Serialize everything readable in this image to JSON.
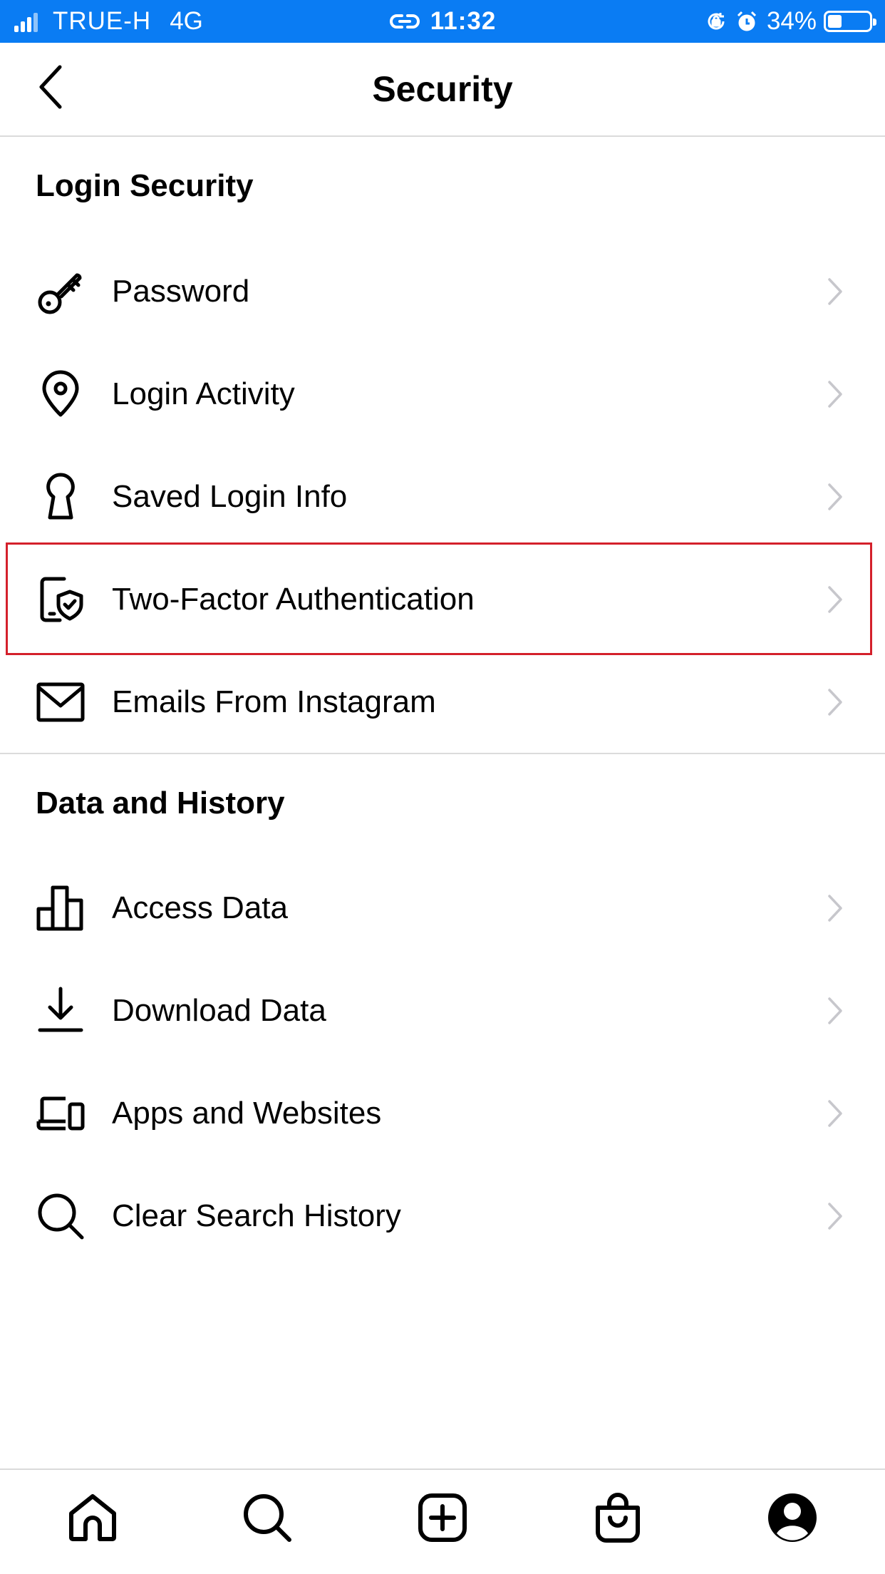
{
  "status_bar": {
    "carrier": "TRUE-H",
    "network": "4G",
    "time": "11:32",
    "battery_percent": "34%",
    "battery_level": 0.34
  },
  "header": {
    "title": "Security"
  },
  "sections": {
    "login_security": {
      "title": "Login Security",
      "items": [
        {
          "label": "Password",
          "icon": "key-icon"
        },
        {
          "label": "Login Activity",
          "icon": "location-pin-icon"
        },
        {
          "label": "Saved Login Info",
          "icon": "keyhole-icon"
        },
        {
          "label": "Two-Factor Authentication",
          "icon": "phone-shield-icon"
        },
        {
          "label": "Emails From Instagram",
          "icon": "envelope-icon"
        }
      ]
    },
    "data_history": {
      "title": "Data and History",
      "items": [
        {
          "label": "Access Data",
          "icon": "bar-chart-icon"
        },
        {
          "label": "Download Data",
          "icon": "download-icon"
        },
        {
          "label": "Apps and Websites",
          "icon": "laptop-phone-icon"
        },
        {
          "label": "Clear Search History",
          "icon": "search-icon"
        }
      ]
    }
  },
  "tab_bar": {
    "tabs": [
      "home-icon",
      "search-icon",
      "create-post-icon",
      "shop-icon",
      "profile-icon"
    ]
  },
  "colors": {
    "status_bar_bg": "#0a7cf3",
    "highlight_border": "#d4202b",
    "divider": "#dbdbdb",
    "chevron": "#c7c7cc"
  }
}
